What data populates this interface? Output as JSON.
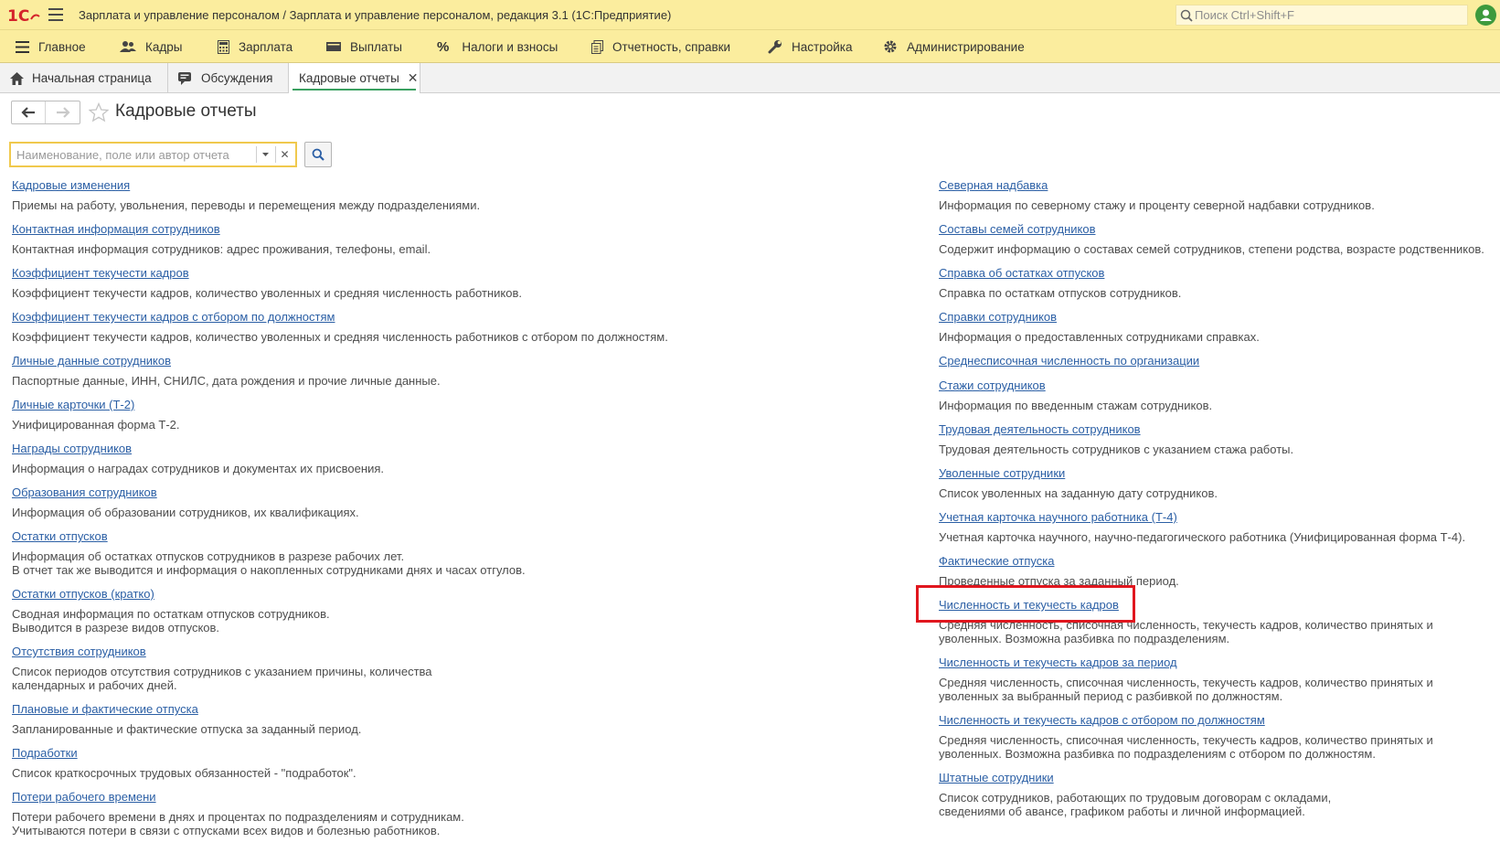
{
  "app": {
    "title": "Зарплата и управление персоналом / Зарплата и управление персоналом, редакция 3.1  (1С:Предприятие)",
    "search_placeholder": "Поиск Ctrl+Shift+F"
  },
  "menu": [
    "Главное",
    "Кадры",
    "Зарплата",
    "Выплаты",
    "Налоги и взносы",
    "Отчетность, справки",
    "Настройка",
    "Администрирование"
  ],
  "tabs": [
    "Начальная страница",
    "Обсуждения",
    "Кадровые отчеты"
  ],
  "page": {
    "title": "Кадровые отчеты",
    "search_placeholder": "Наименование, поле или автор отчета"
  },
  "reports_left": [
    {
      "name": "Кадровые изменения",
      "desc": [
        "Приемы на работу, увольнения, переводы и перемещения между подразделениями."
      ]
    },
    {
      "name": "Контактная информация сотрудников",
      "desc": [
        "Контактная информация сотрудников: адрес проживания, телефоны, email."
      ]
    },
    {
      "name": "Коэффициент текучести кадров",
      "desc": [
        "Коэффициент текучести кадров, количество уволенных и средняя численность работников."
      ]
    },
    {
      "name": "Коэффициент текучести кадров с отбором по должностям",
      "desc": [
        "Коэффициент текучести кадров, количество уволенных и средняя численность работников с отбором по должностям."
      ]
    },
    {
      "name": "Личные данные сотрудников",
      "desc": [
        "Паспортные данные, ИНН, СНИЛС, дата рождения и прочие личные данные."
      ]
    },
    {
      "name": "Личные карточки (Т-2)",
      "desc": [
        "Унифицированная форма Т-2."
      ]
    },
    {
      "name": "Награды сотрудников",
      "desc": [
        "Информация о наградах сотрудников и документах их присвоения."
      ]
    },
    {
      "name": "Образования сотрудников",
      "desc": [
        "Информация об образовании сотрудников, их квалификациях."
      ]
    },
    {
      "name": "Остатки отпусков",
      "desc": [
        "Информация об остатках отпусков сотрудников в разрезе рабочих лет.",
        "В отчет так же выводится и информация о накопленных сотрудниками днях и часах отгулов."
      ]
    },
    {
      "name": "Остатки отпусков (кратко)",
      "desc": [
        "Сводная информация по остаткам отпусков сотрудников.",
        "Выводится в разрезе видов отпусков."
      ]
    },
    {
      "name": "Отсутствия сотрудников",
      "desc": [
        "Список периодов отсутствия сотрудников с указанием причины, количества",
        "календарных и рабочих дней."
      ]
    },
    {
      "name": "Плановые и фактические отпуска",
      "desc": [
        "Запланированные и фактические отпуска за заданный период."
      ]
    },
    {
      "name": "Подработки",
      "desc": [
        "Список краткосрочных трудовых обязанностей - \"подработок\"."
      ]
    },
    {
      "name": "Потери рабочего времени",
      "desc": [
        "Потери рабочего времени в днях и процентах по подразделениям и сотрудникам.",
        "Учитываются потери в связи с отпусками всех видов и болезнью работников."
      ]
    }
  ],
  "reports_right": [
    {
      "name": "Северная надбавка",
      "desc": [
        "Информация по северному стажу и проценту северной надбавки сотрудников."
      ]
    },
    {
      "name": "Составы семей сотрудников",
      "desc": [
        "Содержит информацию о составах семей сотрудников, степени родства, возрасте родственников."
      ]
    },
    {
      "name": "Справка об остатках отпусков",
      "desc": [
        "Справка по остаткам отпусков сотрудников."
      ]
    },
    {
      "name": "Справки сотрудников",
      "desc": [
        "Информация о предоставленных сотрудниками справках."
      ]
    },
    {
      "name": "Среднесписочная численность по организации",
      "desc": []
    },
    {
      "name": "Стажи сотрудников",
      "desc": [
        "Информация по введенным стажам сотрудников."
      ]
    },
    {
      "name": "Трудовая деятельность сотрудников",
      "desc": [
        "Трудовая деятельность сотрудников с указанием стажа работы."
      ]
    },
    {
      "name": "Уволенные сотрудники",
      "desc": [
        "Список уволенных на заданную дату сотрудников."
      ]
    },
    {
      "name": "Учетная карточка научного работника (Т-4)",
      "desc": [
        "Учетная карточка научного, научно-педагогического работника (Унифицированная форма Т-4)."
      ]
    },
    {
      "name": "Фактические отпуска",
      "desc": [
        "Проведенные отпуска за заданный период."
      ]
    },
    {
      "name": "Численность и текучесть кадров",
      "desc": [
        "Средняя численность, списочная численность, текучесть кадров, количество принятых и",
        "уволенных. Возможна разбивка по подразделениям."
      ]
    },
    {
      "name": "Численность и текучесть кадров за период",
      "desc": [
        "Средняя численность, списочная численность, текучесть кадров, количество принятых и",
        "уволенных за выбранный период с разбивкой по должностям."
      ]
    },
    {
      "name": "Численность и текучесть кадров с отбором по должностям",
      "desc": [
        "Средняя численность, списочная численность, текучесть кадров, количество принятых и",
        "уволенных. Возможна разбивка по подразделениям с отбором по должностям."
      ]
    },
    {
      "name": "Штатные сотрудники",
      "desc": [
        "Список сотрудников, работающих по трудовым договорам с окладами,",
        "сведениями об авансе, графиком работы и личной информацией."
      ]
    }
  ],
  "colors": {
    "link": "#2b5fa5",
    "header": "#fbed9e",
    "highlight": "#e0161e"
  }
}
